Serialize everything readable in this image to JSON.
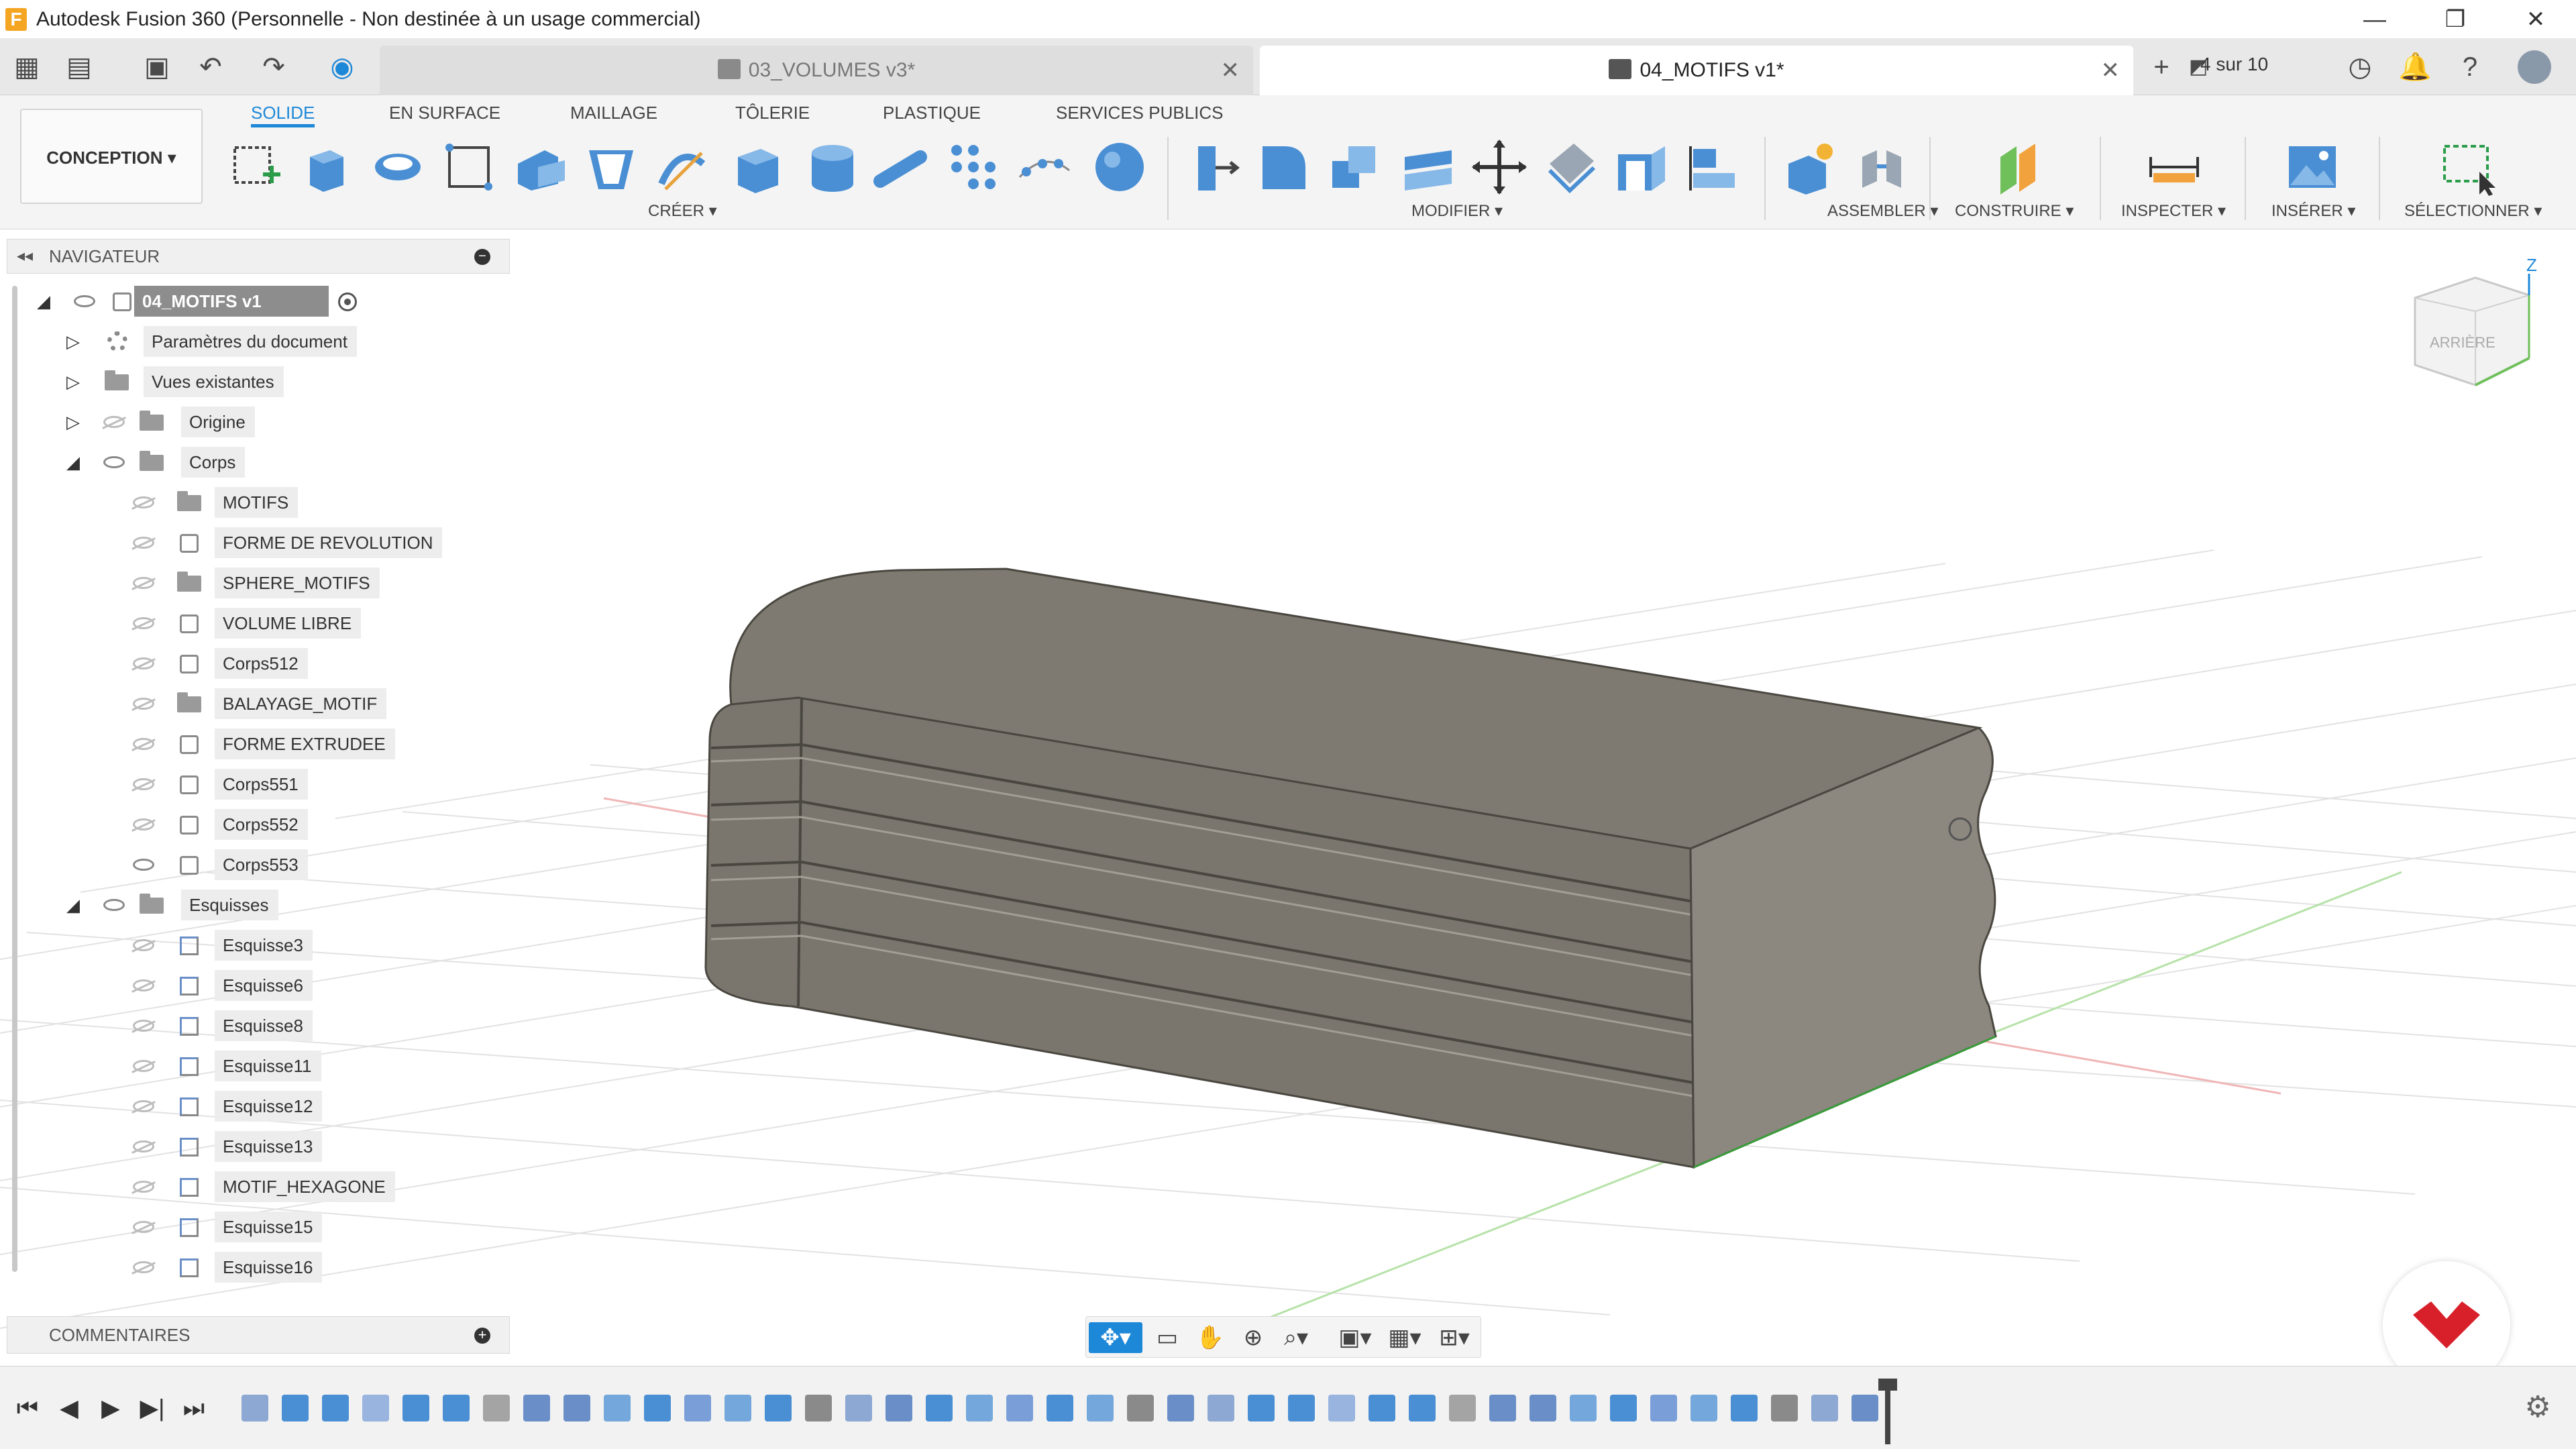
{
  "window": {
    "title": "Autodesk Fusion 360 (Personnelle - Non destinée à un usage commercial)",
    "logo_letter": "F",
    "minimize": "—",
    "restore": "❐",
    "close": "✕"
  },
  "tabs": {
    "items": [
      {
        "label": "03_VOLUMES v3*",
        "close": "✕"
      },
      {
        "label": "04_MOTIFS v1*",
        "close": "✕"
      }
    ],
    "add": "+",
    "count": "4 sur 10"
  },
  "toolbar": {
    "workspace": "CONCEPTION ▾",
    "ribbon_tabs": [
      "SOLIDE",
      "EN SURFACE",
      "MAILLAGE",
      "TÔLERIE",
      "PLASTIQUE",
      "SERVICES PUBLICS"
    ],
    "groups": {
      "create": "CRÉER ▾",
      "modify": "MODIFIER ▾",
      "assemble": "ASSEMBLER ▾",
      "construct": "CONSTRUIRE ▾",
      "inspect": "INSPECTER ▾",
      "insert": "INSÉRER ▾",
      "select": "SÉLECTIONNER ▾"
    },
    "accent": "#1e88d8"
  },
  "navigator": {
    "title": "NAVIGATEUR",
    "collapse": "◂◂",
    "pin": "−",
    "root": "04_MOTIFS v1",
    "doc_settings": "Paramètres du document",
    "named_views": "Vues existantes",
    "origin": "Origine",
    "bodies_folder": "Corps",
    "bodies": [
      {
        "name": "MOTIFS",
        "icon": "folder-icon"
      },
      {
        "name": "FORME DE REVOLUTION",
        "icon": "body-icon"
      },
      {
        "name": "SPHERE_MOTIFS",
        "icon": "folder-icon"
      },
      {
        "name": "VOLUME LIBRE",
        "icon": "body-icon"
      },
      {
        "name": "Corps512",
        "icon": "body-icon"
      },
      {
        "name": "BALAYAGE_MOTIF",
        "icon": "folder-icon"
      },
      {
        "name": "FORME EXTRUDEE",
        "icon": "body-icon"
      },
      {
        "name": "Corps551",
        "icon": "body-icon"
      },
      {
        "name": "Corps552",
        "icon": "body-icon"
      },
      {
        "name": "Corps553",
        "icon": "body-icon"
      }
    ],
    "sketches_folder": "Esquisses",
    "sketches": [
      "Esquisse3",
      "Esquisse6",
      "Esquisse8",
      "Esquisse11",
      "Esquisse12",
      "Esquisse13",
      "MOTIF_HEXAGONE",
      "Esquisse15",
      "Esquisse16"
    ]
  },
  "comments": {
    "title": "COMMENTAIRES",
    "add": "+"
  },
  "viewcube": {
    "face": "ARRIÈRE",
    "axis": "Z"
  },
  "timeline": {
    "controls": [
      "⏮",
      "◀",
      "▶",
      "▶|",
      "⏭"
    ],
    "settings": "⚙"
  }
}
